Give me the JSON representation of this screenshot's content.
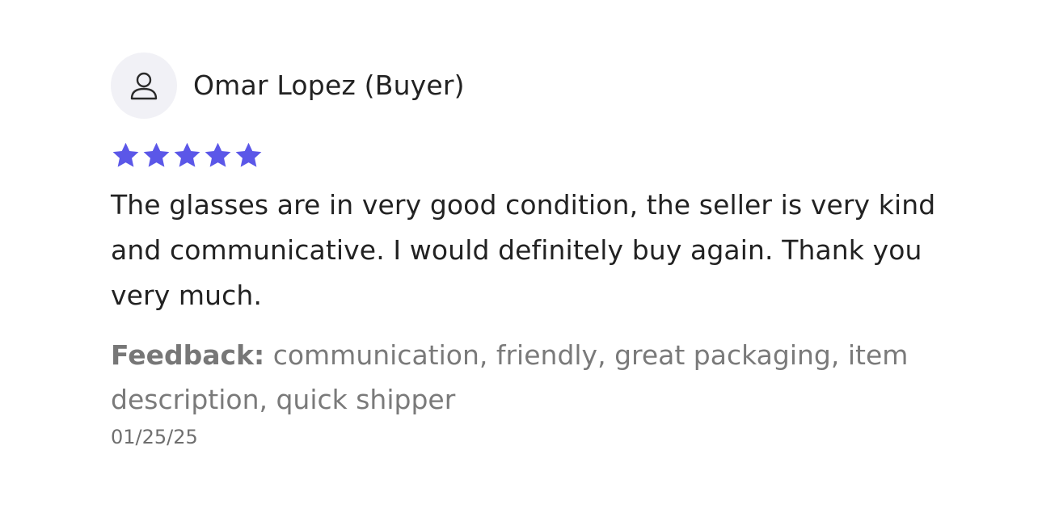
{
  "review": {
    "reviewer": "Omar Lopez (Buyer)",
    "avatar_icon": "user-outline-icon",
    "rating": 5,
    "rating_max": 5,
    "star_color": "#5b57e8",
    "text": "The glasses are in very good condition, the seller is very kind and communicative. I would definitely buy again. Thank you very much.",
    "feedback_label": "Feedback:",
    "feedback_tags": "communication, friendly, great packaging, item description, quick shipper",
    "date": "01/25/25"
  }
}
